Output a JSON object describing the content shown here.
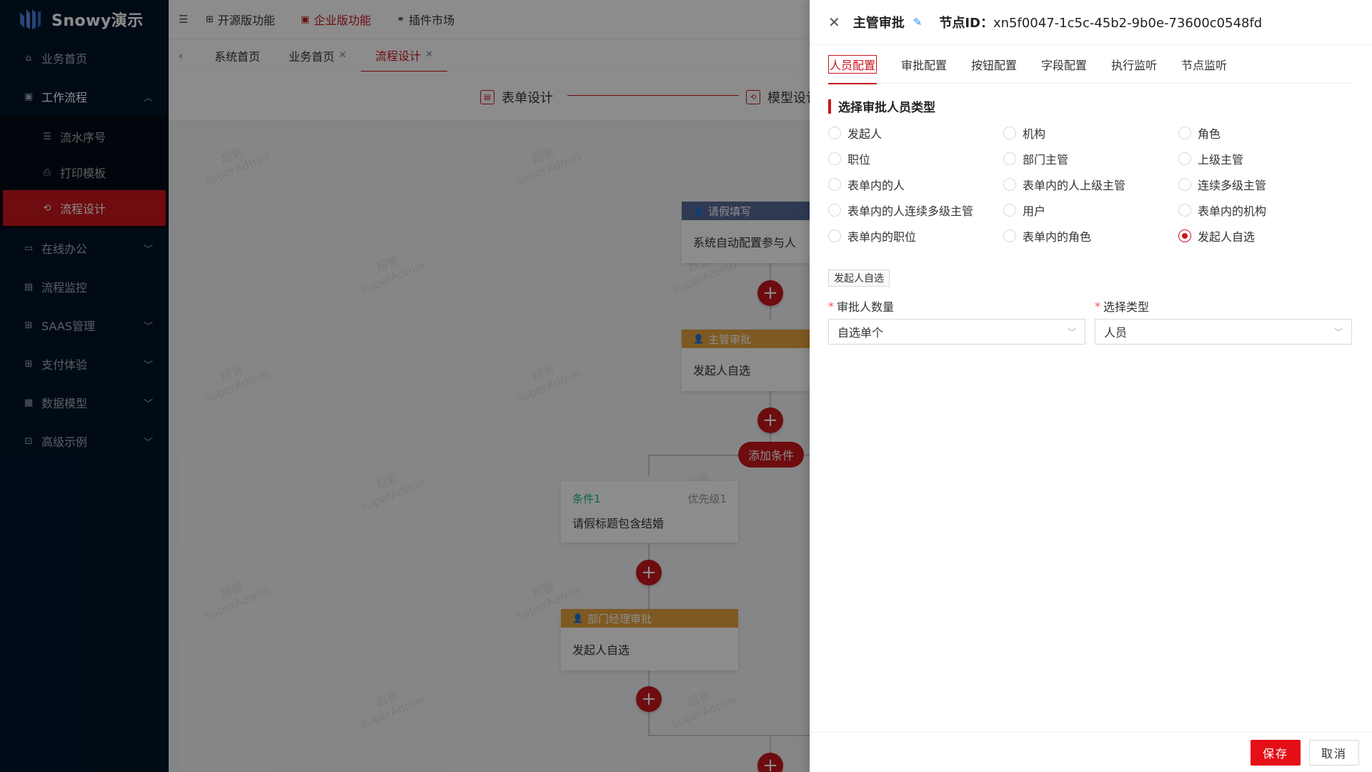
{
  "brand": {
    "name": "Snowy演示"
  },
  "sidebar": {
    "items": [
      {
        "label": "业务首页",
        "icon": "home-icon"
      },
      {
        "label": "工作流程",
        "icon": "form-icon",
        "open": true,
        "children": [
          {
            "label": "流水序号",
            "icon": "list-icon"
          },
          {
            "label": "打印模板",
            "icon": "printer-icon"
          },
          {
            "label": "流程设计",
            "icon": "flow-icon",
            "active": true
          }
        ]
      },
      {
        "label": "在线办公",
        "icon": "desktop-icon"
      },
      {
        "label": "流程监控",
        "icon": "monitor-icon"
      },
      {
        "label": "SAAS管理",
        "icon": "grid-icon"
      },
      {
        "label": "支付体验",
        "icon": "grid-icon"
      },
      {
        "label": "数据模型",
        "icon": "table-icon"
      },
      {
        "label": "高级示例",
        "icon": "code-icon"
      }
    ]
  },
  "topnav": {
    "items": [
      "开源版功能",
      "企业版功能",
      "插件市场"
    ]
  },
  "tabs": {
    "items": [
      "系统首页",
      "业务首页",
      "流程设计"
    ]
  },
  "steps": {
    "form_design": "表单设计",
    "model_design": "模型设计"
  },
  "watermark": {
    "line1": "超管",
    "line2": "superAdmin"
  },
  "flow": {
    "node1": {
      "title": "请假填写",
      "body": "系统自动配置参与人"
    },
    "node2": {
      "title": "主管审批",
      "body": "发起人自选"
    },
    "add_condition": "添加条件",
    "condition1": {
      "name": "条件1",
      "priority": "优先级1",
      "desc": "请假标题包含结婚"
    },
    "node3": {
      "title": "部门经理审批",
      "body": "发起人自选"
    }
  },
  "drawer": {
    "title": "主管审批",
    "node_id_label": "节点ID：",
    "node_id": "xn5f0047-1c5c-45b2-9b0e-73600c0548fd",
    "tabs": [
      "人员配置",
      "审批配置",
      "按钮配置",
      "字段配置",
      "执行监听",
      "节点监听"
    ],
    "section_title": "选择审批人员类型",
    "radios": [
      "发起人",
      "机构",
      "角色",
      "职位",
      "部门主管",
      "上级主管",
      "表单内的人",
      "表单内的人上级主管",
      "连续多级主管",
      "表单内的人连续多级主管",
      "用户",
      "表单内的机构",
      "表单内的职位",
      "表单内的角色",
      "发起人自选"
    ],
    "selected_radio": "发起人自选",
    "tag": "发起人自选",
    "field1": {
      "label": "审批人数量",
      "value": "自选单个"
    },
    "field2": {
      "label": "选择类型",
      "value": "人员"
    },
    "save": "保存",
    "cancel": "取消"
  },
  "colors": {
    "primary": "#c8161d",
    "sidebar_bg": "#001529",
    "node_blue": "#576a95",
    "node_orange": "#e6a23c",
    "condition_green": "#15bc83"
  }
}
